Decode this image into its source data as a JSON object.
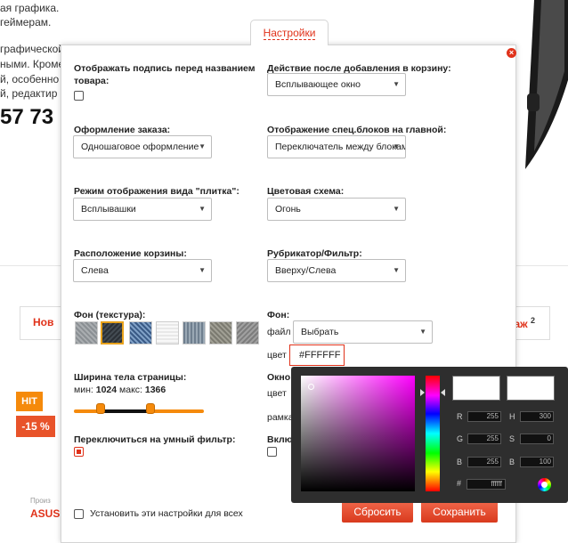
{
  "background": {
    "lines": [
      "ая графика.",
      "геймерам.",
      "графической",
      "ными. Кроме",
      "й, особенно",
      "й, редактир"
    ],
    "phone": "57 73",
    "nav_left": "Нов",
    "nav_right": "аж",
    "nav_right_count": "2",
    "hit_badge": "HIT",
    "sale_badge": "-15 %",
    "brand_small": "Произ",
    "brand": "ASUS"
  },
  "panel": {
    "tab_label": "Настройки",
    "close_icon": "×",
    "show_caption_label": "Отображать подпись перед названием товара:",
    "cart_action_label": "Действие после добавления в корзину:",
    "cart_action_value": "Всплывающее окно",
    "order_design_label": "Оформление заказа:",
    "order_design_value": "Одношаговое оформление",
    "special_blocks_label": "Отображение спец.блоков на главной:",
    "special_blocks_value": "Переключатель между блоками",
    "tile_mode_label": "Режим отображения вида \"плитка\":",
    "tile_mode_value": "Всплывашки",
    "color_scheme_label": "Цветовая схема:",
    "color_scheme_value": "Огонь",
    "cart_position_label": "Расположение корзины:",
    "cart_position_value": "Слева",
    "rubricator_label": "Рубрикатор/Фильтр:",
    "rubricator_value": "Вверху/Слева",
    "bg_texture_label": "Фон (текстура):",
    "bg_label": "Фон:",
    "file_label": "файл",
    "file_value": "Выбрать",
    "color_label": "цвет",
    "color_value": "#FFFFFF",
    "width_label": "Ширина тела страницы:",
    "width_min_label": "мин:",
    "width_min": "1024",
    "width_max_label": "макс:",
    "width_max": "1366",
    "window_label": "Окно",
    "color_label2": "цвет",
    "frame_label": "рамка",
    "smart_filter_label": "Переключиться на умный фильтр:",
    "enable_label": "Вклю",
    "apply_all_label": "Установить эти настройки для всех",
    "reset_label": "Сбросить",
    "save_label": "Сохранить",
    "accent_color": "#e0321a"
  },
  "picker": {
    "R1": "255",
    "G1": "255",
    "B1": "255",
    "H": "300",
    "S": "0",
    "B2": "100",
    "hex": "ffffff",
    "labels": {
      "R": "R",
      "G": "G",
      "B": "B",
      "H": "H",
      "S": "S",
      "hash": "#"
    }
  }
}
